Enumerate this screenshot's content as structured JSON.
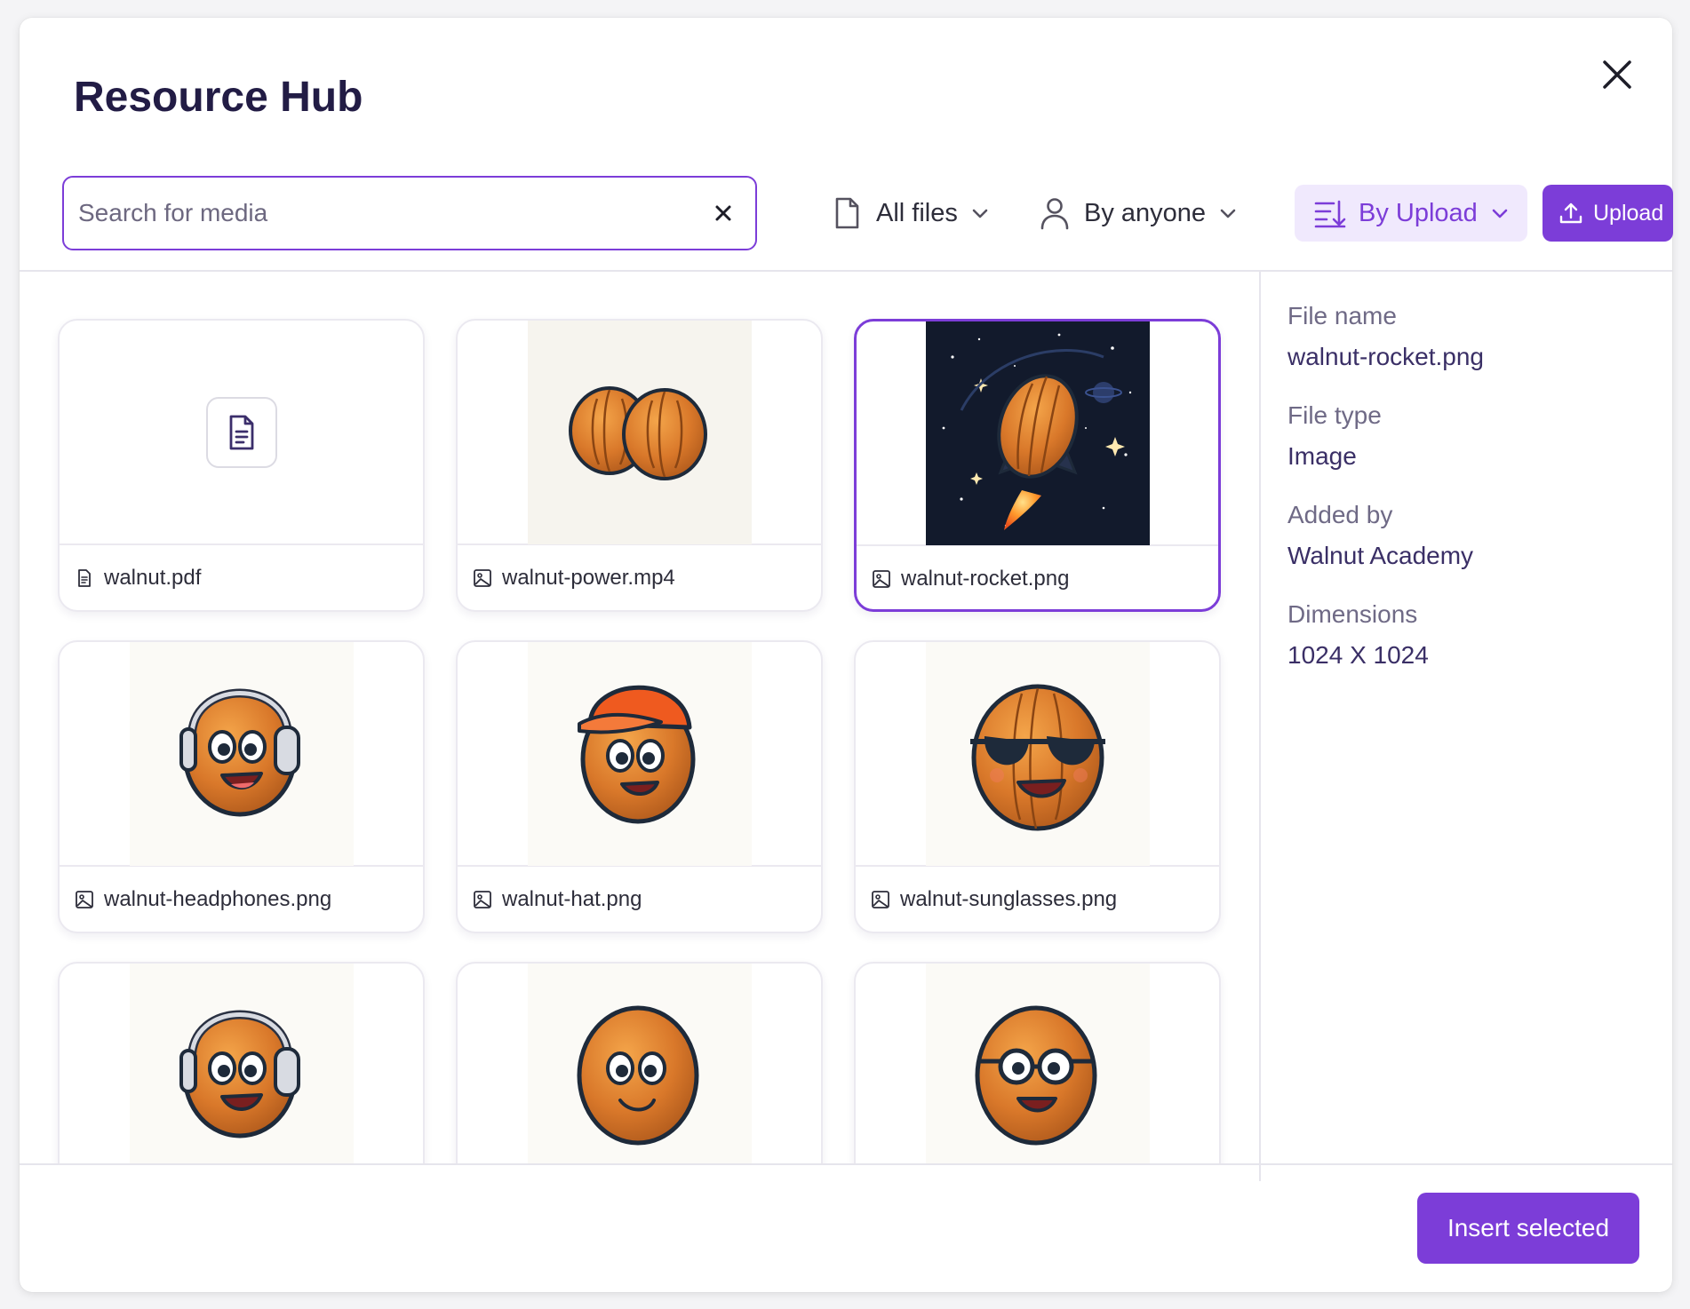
{
  "modal": {
    "title": "Resource Hub"
  },
  "search": {
    "placeholder": "Search for media",
    "value": ""
  },
  "filters": {
    "file_type": "All files",
    "author": "By anyone",
    "sort": "By Upload"
  },
  "upload_label": "Upload",
  "items": [
    {
      "name": "walnut.pdf",
      "kind": "document"
    },
    {
      "name": "walnut-power.mp4",
      "kind": "image"
    },
    {
      "name": "walnut-rocket.png",
      "kind": "image",
      "selected": true
    },
    {
      "name": "walnut-headphones.png",
      "kind": "image"
    },
    {
      "name": "walnut-hat.png",
      "kind": "image"
    },
    {
      "name": "walnut-sunglasses.png",
      "kind": "image"
    },
    {
      "name": "",
      "kind": "image"
    },
    {
      "name": "",
      "kind": "image"
    },
    {
      "name": "",
      "kind": "image"
    }
  ],
  "details": {
    "file_name_label": "File name",
    "file_name": "walnut-rocket.png",
    "file_type_label": "File type",
    "file_type": "Image",
    "added_by_label": "Added by",
    "added_by": "Walnut Academy",
    "dimensions_label": "Dimensions",
    "dimensions": "1024 X 1024"
  },
  "insert_label": "Insert selected",
  "colors": {
    "accent": "#7c3dd8",
    "accent_soft": "#f0e9fd",
    "text_dark": "#221c45",
    "text_muted": "#6f6a86"
  }
}
